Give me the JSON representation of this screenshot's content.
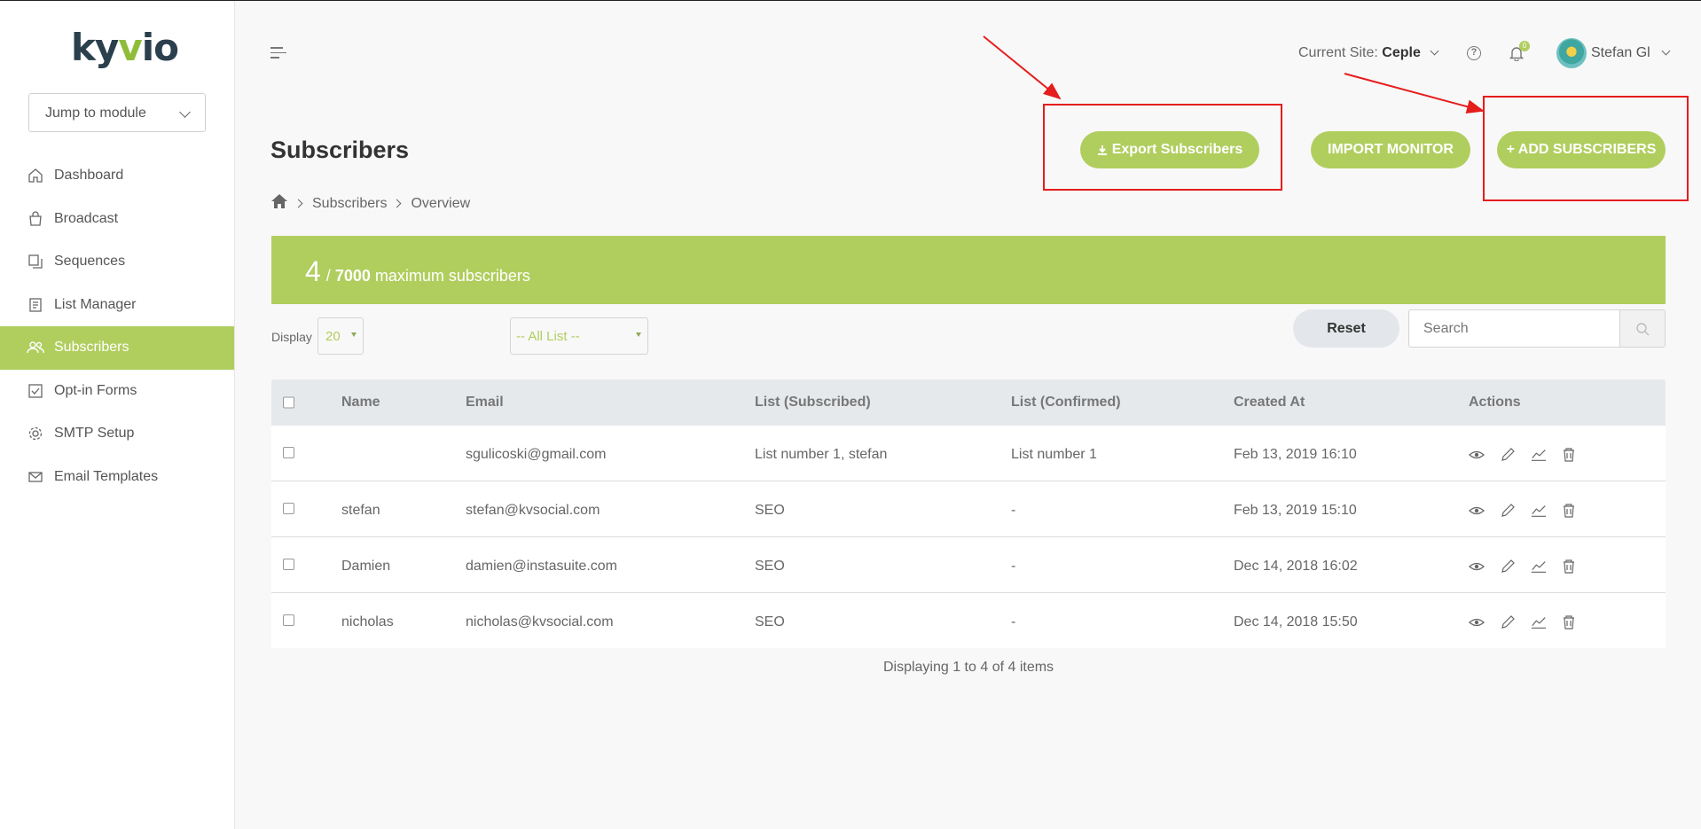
{
  "brand": {
    "logo_text_a": "ky",
    "logo_text_b": "v",
    "logo_text_c": "io"
  },
  "sidebar": {
    "jump_label": "Jump to module",
    "items": [
      {
        "label": "Dashboard",
        "icon": "home-icon"
      },
      {
        "label": "Broadcast",
        "icon": "bag-icon"
      },
      {
        "label": "Sequences",
        "icon": "sequences-icon"
      },
      {
        "label": "List Manager",
        "icon": "list-icon"
      },
      {
        "label": "Subscribers",
        "icon": "users-icon",
        "active": true
      },
      {
        "label": "Opt-in Forms",
        "icon": "checkbox-icon"
      },
      {
        "label": "SMTP Setup",
        "icon": "gear-icon"
      },
      {
        "label": "Email Templates",
        "icon": "mail-icon"
      }
    ]
  },
  "topbar": {
    "site_label": "Current Site:",
    "site_value": "Ceple",
    "notif_count": "0",
    "user_name": "Stefan Gl"
  },
  "page": {
    "title": "Subscribers",
    "export_label": "Export Subscribers",
    "import_label": "IMPORT MONITOR",
    "add_label": "+ ADD SUBSCRIBERS",
    "breadcrumb": {
      "item1": "Subscribers",
      "item2": "Overview"
    }
  },
  "banner": {
    "count": "4",
    "separator": "/",
    "max": "7000",
    "suffix": "maximum subscribers"
  },
  "controls": {
    "display_label": "Display",
    "display_value": "20",
    "list_value": "-- All List --",
    "reset_label": "Reset",
    "search_placeholder": "Search"
  },
  "table": {
    "columns": [
      "Name",
      "Email",
      "List (Subscribed)",
      "List (Confirmed)",
      "Created At",
      "Actions"
    ],
    "rows": [
      {
        "name": "",
        "email": "sgulicoski@gmail.com",
        "list_sub": "List number 1, stefan",
        "list_conf": "List number 1",
        "created": "Feb 13, 2019 16:10"
      },
      {
        "name": "stefan",
        "email": "stefan@kvsocial.com",
        "list_sub": "SEO",
        "list_conf": "-",
        "created": "Feb 13, 2019 15:10"
      },
      {
        "name": "Damien",
        "email": "damien@instasuite.com",
        "list_sub": "SEO",
        "list_conf": "-",
        "created": "Dec 14, 2018 16:02"
      },
      {
        "name": "nicholas",
        "email": "nicholas@kvsocial.com",
        "list_sub": "SEO",
        "list_conf": "-",
        "created": "Dec 14, 2018 15:50"
      }
    ],
    "footer": "Displaying 1 to 4 of 4 items"
  },
  "colors": {
    "accent": "#b0ce5e",
    "highlight": "#e51d1d",
    "logo": "#2b3f4d"
  }
}
